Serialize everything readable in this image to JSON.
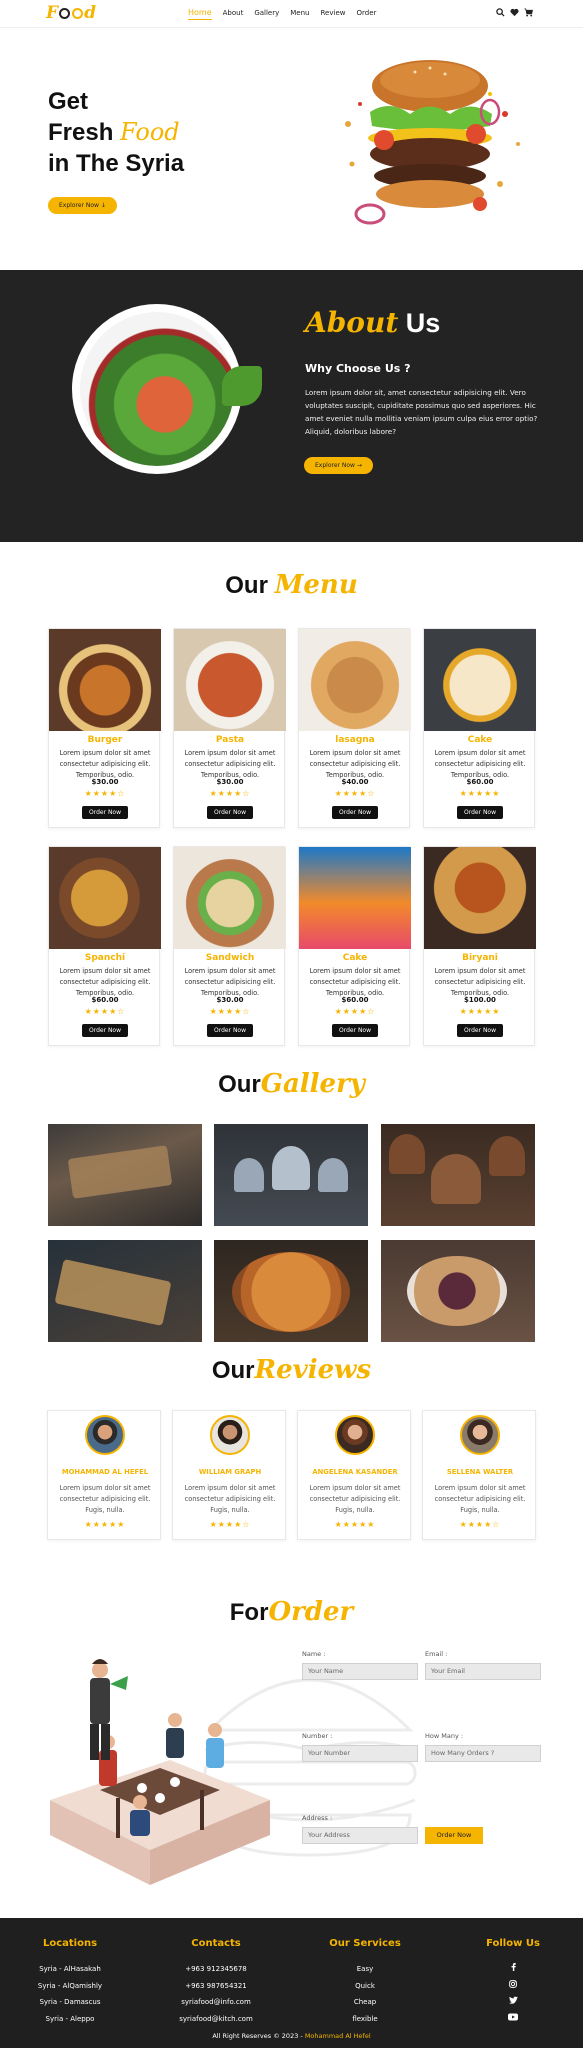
{
  "nav": {
    "logo_pre": "F",
    "logo_post": "d",
    "links": [
      "Home",
      "About",
      "Gallery",
      "Menu",
      "Review",
      "Order"
    ],
    "icons": [
      "search-icon",
      "heart-icon",
      "cart-icon"
    ]
  },
  "hero": {
    "line1": "Get",
    "line2a": "Fresh ",
    "line2b": "Food",
    "line3": "in The Syria",
    "button": "Explorer Now"
  },
  "about": {
    "title_a": "About",
    "title_b": " Us",
    "subtitle": "Why Choose Us ?",
    "text": "Lorem ipsum dolor sit, amet consectetur adipisicing elit. Vero voluptates suscipit, cupiditate possimus quo sed asperiores. Hic amet eveniet nulla mollitia veniam ipsum culpa eius error optio? Aliquid, doloribus labore?",
    "button": "Explorer Now →"
  },
  "menu": {
    "title_a": "Our ",
    "title_b": "Menu",
    "desc": "Lorem ipsum dolor sit amet consectetur adipisicing elit. Temporibus, odio.",
    "order_label": "Order Now",
    "items": [
      {
        "name": "Burger",
        "price": "$30.00",
        "stars": "★★★★☆",
        "rating": 4.5
      },
      {
        "name": "Pasta",
        "price": "$30.00",
        "stars": "★★★★☆",
        "rating": 4.5
      },
      {
        "name": "lasagna",
        "price": "$40.00",
        "stars": "★★★★☆",
        "rating": 4.5
      },
      {
        "name": "Cake",
        "price": "$60.00",
        "stars": "★★★★★",
        "rating": 5
      },
      {
        "name": "Spanchi",
        "price": "$60.00",
        "stars": "★★★★☆",
        "rating": 4.5
      },
      {
        "name": "Sandwich",
        "price": "$30.00",
        "stars": "★★★★☆",
        "rating": 4.5
      },
      {
        "name": "Cake",
        "price": "$60.00",
        "stars": "★★★★☆",
        "rating": 4.5
      },
      {
        "name": "Biryani",
        "price": "$100.00",
        "stars": "★★★★★",
        "rating": 5
      }
    ]
  },
  "gallery": {
    "title_a": "Our",
    "title_b": "Gallery"
  },
  "reviews": {
    "title_a": "Our",
    "title_b": "Reviews",
    "text": "Lorem ipsum dolor sit amet consectetur adipisicing elit. Fugis, nulla.",
    "items": [
      {
        "name": "MOHAMMAD AL HEFEL",
        "stars": "★★★★★",
        "rating": 5
      },
      {
        "name": "WILLIAM GRAPH",
        "stars": "★★★★☆",
        "rating": 4.5
      },
      {
        "name": "ANGELENA KASANDER",
        "stars": "★★★★★",
        "rating": 5
      },
      {
        "name": "SELLENA WALTER",
        "stars": "★★★★☆",
        "rating": 4.5
      }
    ]
  },
  "order": {
    "title_a": "For",
    "title_b": "Order",
    "name_label": "Name :",
    "name_ph": "Your Name",
    "email_label": "Email :",
    "email_ph": "Your Email",
    "number_label": "Number :",
    "number_ph": "Your Number",
    "howmany_label": "How Many :",
    "howmany_ph": "How Many Orders ?",
    "address_label": "Address :",
    "address_ph": "Your Address",
    "button": "Order Now"
  },
  "footer": {
    "locations_head": "Locations",
    "locations": [
      "Syria - AlHasakah",
      "Syria - AlQamishly",
      "Syria - Damascus",
      "Syria - Aleppo"
    ],
    "contacts_head": "Contacts",
    "contacts": [
      "+963 912345678",
      "+963 987654321",
      "syriafood@info.com",
      "syriafood@kitch.com"
    ],
    "services_head": "Our Services",
    "services": [
      "Easy",
      "Quick",
      "Cheap",
      "flexible"
    ],
    "follow_head": "Follow Us",
    "social": [
      "facebook-icon",
      "instagram-icon",
      "twitter-icon",
      "youtube-icon"
    ],
    "copy": "All Right Reserves © 2023 - ",
    "copy_name": "Mohammad Al Hefel"
  },
  "colors": {
    "accent": "#f5b400",
    "dark": "#232323",
    "footer": "#1f1f1f"
  }
}
